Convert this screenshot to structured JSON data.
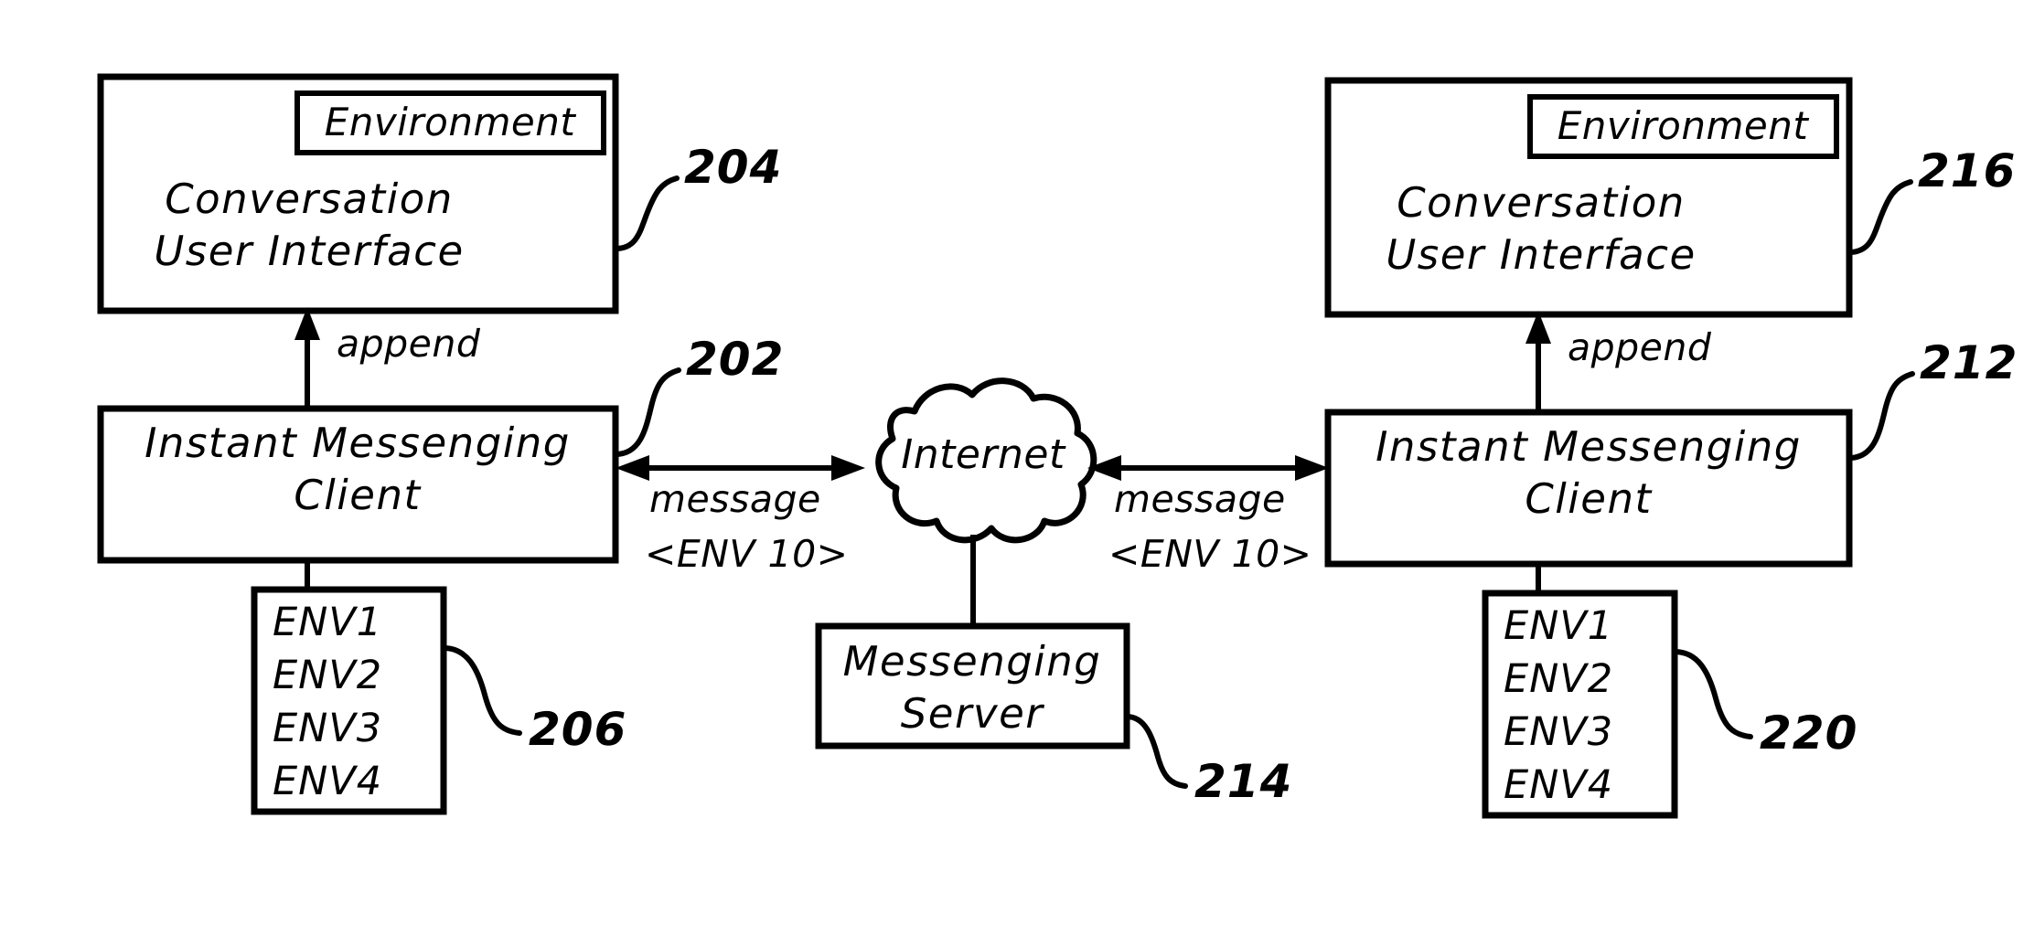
{
  "figure": {
    "type": "patent-diagram",
    "background_color": "#ffffff",
    "line_color": "#000000"
  },
  "left_client": {
    "conversation_ui": {
      "environment_label": "Environment",
      "line1": "Conversation",
      "line2": "User Interface",
      "reference_numeral": "204"
    },
    "append_edge_label": "append",
    "im_client": {
      "line1": "Instant Messenging",
      "line2": "Client",
      "reference_numeral": "202"
    },
    "env_list": {
      "items": [
        "ENV1",
        "ENV2",
        "ENV3",
        "ENV4"
      ],
      "reference_numeral": "206"
    },
    "message_edge": {
      "line1": "message",
      "line2": "<ENV 10>"
    }
  },
  "network": {
    "cloud_label": "Internet",
    "server": {
      "line1": "Messenging",
      "line2": "Server",
      "reference_numeral": "214"
    }
  },
  "right_client": {
    "conversation_ui": {
      "environment_label": "Environment",
      "line1": "Conversation",
      "line2": "User Interface",
      "reference_numeral": "216"
    },
    "append_edge_label": "append",
    "im_client": {
      "line1": "Instant Messenging",
      "line2": "Client",
      "reference_numeral": "212"
    },
    "env_list": {
      "items": [
        "ENV1",
        "ENV2",
        "ENV3",
        "ENV4"
      ],
      "reference_numeral": "220"
    },
    "message_edge": {
      "line1": "message",
      "line2": "<ENV 10>"
    }
  }
}
